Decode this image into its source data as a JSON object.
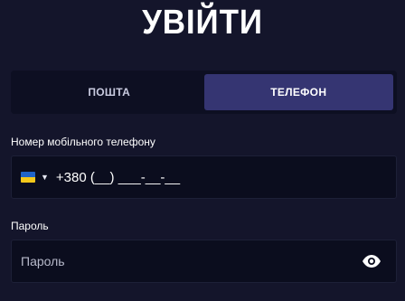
{
  "title": "УВІЙТИ",
  "tabs": [
    {
      "label": "ПОШТА",
      "active": false
    },
    {
      "label": "ТЕЛЕФОН",
      "active": true
    }
  ],
  "phone": {
    "label": "Номер мобільного телефону",
    "country_flag": "ukraine-flag-icon",
    "value": "+380 (__) ___-__-__"
  },
  "password": {
    "label": "Пароль",
    "placeholder": "Пароль",
    "toggle_icon": "eye-icon"
  },
  "colors": {
    "background": "#14152b",
    "tab_active": "#353572",
    "field_bg": "#0b0d1e"
  }
}
